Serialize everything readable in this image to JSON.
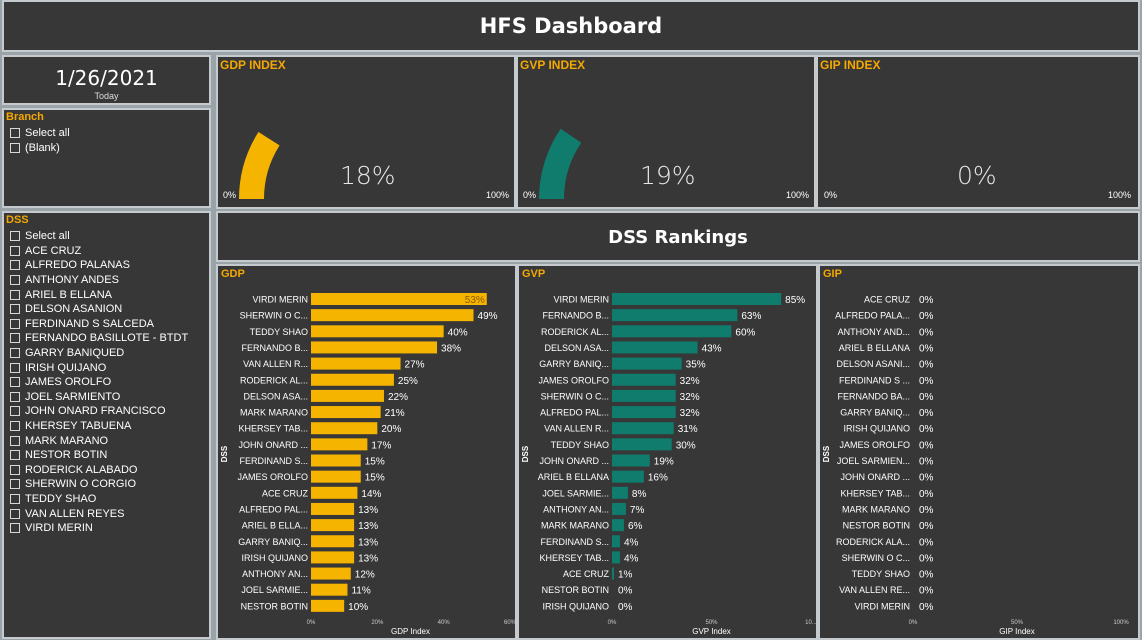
{
  "header": {
    "title": "HFS Dashboard"
  },
  "date_card": {
    "value": "1/26/2021",
    "label": "Today"
  },
  "branch_slicer": {
    "title": "Branch",
    "items": [
      "Select all",
      "(Blank)"
    ]
  },
  "dss_slicer": {
    "title": "DSS",
    "items": [
      "Select all",
      "ACE CRUZ",
      "ALFREDO PALANAS",
      "ANTHONY ANDES",
      "ARIEL B ELLANA",
      "DELSON ASANION",
      "FERDINAND S SALCEDA",
      "FERNANDO BASILLOTE - BTDT",
      "GARRY BANIQUED",
      "IRISH QUIJANO",
      "JAMES OROLFO",
      "JOEL SARMIENTO",
      "JOHN ONARD FRANCISCO",
      "KHERSEY TABUENA",
      "MARK MARANO",
      "NESTOR BOTIN",
      "RODERICK ALABADO",
      "SHERWIN O CORGIO",
      "TEDDY SHAO",
      "VAN ALLEN REYES",
      "VIRDI MERIN"
    ]
  },
  "gauges": [
    {
      "title": "GDP INDEX",
      "value": 0.18,
      "value_label": "18%",
      "min_label": "0%",
      "max_label": "100%",
      "color": "#f5b400"
    },
    {
      "title": "GVP INDEX",
      "value": 0.19,
      "value_label": "19%",
      "min_label": "0%",
      "max_label": "100%",
      "color": "#0f7c6e"
    },
    {
      "title": "GIP INDEX",
      "value": 0.0,
      "value_label": "0%",
      "min_label": "0%",
      "max_label": "100%",
      "color": "#0f7c6e"
    }
  ],
  "rankings": {
    "title": "DSS Rankings"
  },
  "colors": {
    "gdp": "#f5b400",
    "gvp": "#0f7c6e",
    "panel_bg": "#373737",
    "accent": "#f5a800"
  },
  "chart_data": [
    {
      "type": "bar",
      "title": "GDP",
      "xlabel": "GDP Index",
      "ylabel": "DSS",
      "xticks": [
        "0%",
        "20%",
        "40%",
        "60%"
      ],
      "xlim": [
        0,
        60
      ],
      "categories": [
        "VIRDI MERIN",
        "SHERWIN O C...",
        "TEDDY SHAO",
        "FERNANDO B...",
        "VAN ALLEN R...",
        "RODERICK AL...",
        "DELSON ASA...",
        "MARK MARANO",
        "KHERSEY TAB...",
        "JOHN ONARD ...",
        "FERDINAND S...",
        "JAMES OROLFO",
        "ACE CRUZ",
        "ALFREDO PAL...",
        "ARIEL B ELLA...",
        "GARRY BANIQ...",
        "IRISH QUIJANO",
        "ANTHONY AN...",
        "JOEL SARMIE...",
        "NESTOR BOTIN"
      ],
      "values": [
        53,
        49,
        40,
        38,
        27,
        25,
        22,
        21,
        20,
        17,
        15,
        15,
        14,
        13,
        13,
        13,
        13,
        12,
        11,
        10
      ],
      "labels": [
        "53%",
        "49%",
        "40%",
        "38%",
        "27%",
        "25%",
        "22%",
        "21%",
        "20%",
        "17%",
        "15%",
        "15%",
        "14%",
        "13%",
        "13%",
        "13%",
        "13%",
        "12%",
        "11%",
        "10%"
      ]
    },
    {
      "type": "bar",
      "title": "GVP",
      "xlabel": "GVP Index",
      "ylabel": "DSS",
      "xticks": [
        "0%",
        "50%",
        "10..."
      ],
      "xlim": [
        0,
        100
      ],
      "categories": [
        "VIRDI MERIN",
        "FERNANDO B...",
        "RODERICK AL...",
        "DELSON ASA...",
        "GARRY BANIQ...",
        "JAMES OROLFO",
        "SHERWIN O C...",
        "ALFREDO PAL...",
        "VAN ALLEN R...",
        "TEDDY SHAO",
        "JOHN ONARD ...",
        "ARIEL B ELLANA",
        "JOEL SARMIE...",
        "ANTHONY AN...",
        "MARK MARANO",
        "FERDINAND S...",
        "KHERSEY TAB...",
        "ACE CRUZ",
        "NESTOR BOTIN",
        "IRISH QUIJANO"
      ],
      "values": [
        85,
        63,
        60,
        43,
        35,
        32,
        32,
        32,
        31,
        30,
        19,
        16,
        8,
        7,
        6,
        4,
        4,
        1,
        0,
        0
      ],
      "labels": [
        "85%",
        "63%",
        "60%",
        "43%",
        "35%",
        "32%",
        "32%",
        "32%",
        "31%",
        "30%",
        "19%",
        "16%",
        "8%",
        "7%",
        "6%",
        "4%",
        "4%",
        "1%",
        "0%",
        "0%"
      ]
    },
    {
      "type": "bar",
      "title": "GIP",
      "xlabel": "GIP Index",
      "ylabel": "DSS",
      "xticks": [
        "0%",
        "50%",
        "100%"
      ],
      "xlim": [
        0,
        100
      ],
      "categories": [
        "ACE CRUZ",
        "ALFREDO PALA...",
        "ANTHONY AND...",
        "ARIEL B ELLANA",
        "DELSON ASANI...",
        "FERDINAND S ...",
        "FERNANDO BA...",
        "GARRY BANIQ...",
        "IRISH QUIJANO",
        "JAMES OROLFO",
        "JOEL SARMIEN...",
        "JOHN ONARD ...",
        "KHERSEY TAB...",
        "MARK MARANO",
        "NESTOR BOTIN",
        "RODERICK ALA...",
        "SHERWIN O C...",
        "TEDDY SHAO",
        "VAN ALLEN RE...",
        "VIRDI MERIN"
      ],
      "values": [
        0,
        0,
        0,
        0,
        0,
        0,
        0,
        0,
        0,
        0,
        0,
        0,
        0,
        0,
        0,
        0,
        0,
        0,
        0,
        0
      ],
      "labels": [
        "0%",
        "0%",
        "0%",
        "0%",
        "0%",
        "0%",
        "0%",
        "0%",
        "0%",
        "0%",
        "0%",
        "0%",
        "0%",
        "0%",
        "0%",
        "0%",
        "0%",
        "0%",
        "0%",
        "0%"
      ]
    }
  ]
}
